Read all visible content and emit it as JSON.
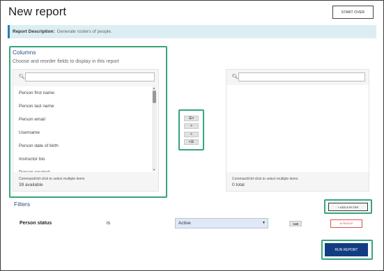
{
  "page": {
    "title": "New report",
    "start_over_label": "START OVER"
  },
  "description": {
    "label": "Report Description:",
    "value": "Generate rosters of people."
  },
  "columns": {
    "heading": "Columns",
    "subheading": "Choose and reorder fields to display in this report",
    "available": {
      "search_icon": "search-icon",
      "search_placeholder": "",
      "items": [
        "Person first name",
        "Person last name",
        "Person email",
        "Username",
        "Person date of birth",
        "Instructor bio",
        "Person created"
      ],
      "note": "Command/ctrl-click to select multiple items",
      "count": "39 available"
    },
    "selected": {
      "search_icon": "search-icon",
      "search_placeholder": "",
      "items": [],
      "note": "Command/ctrl-click to select multiple items",
      "count": "0 total"
    },
    "move_buttons": {
      "add_all": "☰>",
      "add": ">",
      "remove": "<",
      "remove_all": "<☰"
    }
  },
  "filters": {
    "heading": "Filters",
    "add_label": "+ ADD A FILTER",
    "rows": [
      {
        "field": "Person status",
        "operator": "is",
        "value": "Active",
        "or_label": "+OR",
        "remove_label": "⊗ REMOVE"
      }
    ]
  },
  "run_label": "RUN REPORT",
  "colors": {
    "accent": "#35a57a",
    "primary": "#123d82",
    "heading": "#2a4f86",
    "danger": "#d9534f"
  }
}
